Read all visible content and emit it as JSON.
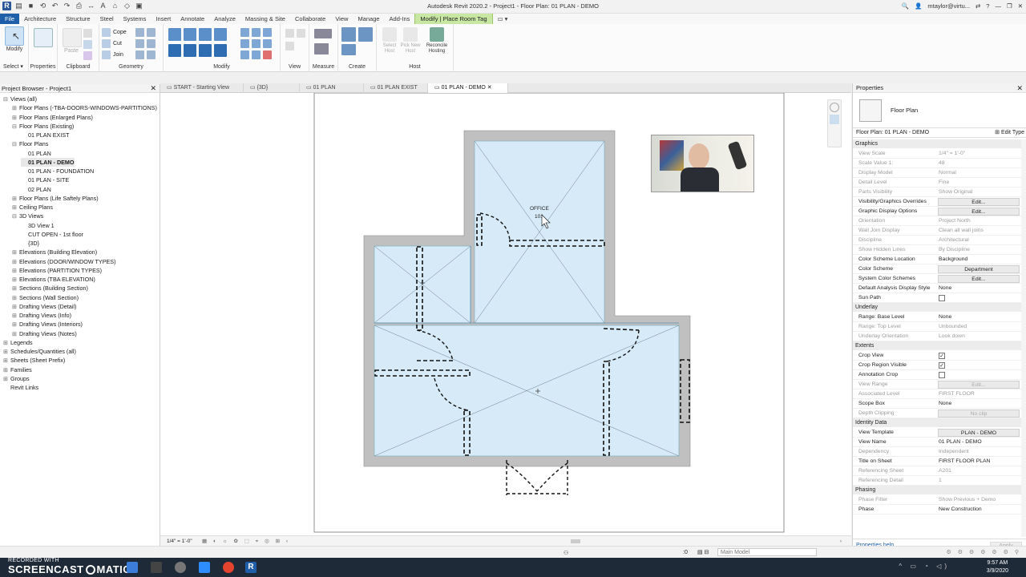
{
  "title": "Autodesk Revit 2020.2 - Project1 - Floor Plan: 01 PLAN - DEMO",
  "user": "mtaylor@virtu...",
  "ribbon_tabs": [
    "File",
    "Architecture",
    "Structure",
    "Steel",
    "Systems",
    "Insert",
    "Annotate",
    "Analyze",
    "Massing & Site",
    "Collaborate",
    "View",
    "Manage",
    "Add-Ins",
    "Modify | Place Room Tag"
  ],
  "ribbon": {
    "modify": "Modify",
    "select": "Select",
    "properties": "Properties",
    "clipboard": "Clipboard",
    "paste": "Paste",
    "cope": "Cope",
    "cut": "Cut",
    "join": "Join",
    "geometry": "Geometry",
    "modify_panel": "Modify",
    "view": "View",
    "measure": "Measure",
    "create": "Create",
    "host": "Host",
    "select_host": "Select Host",
    "pick_new_host": "Pick New Host",
    "reconcile_hosting": "Reconcile Hosting"
  },
  "project_browser": {
    "title": "Project Browser - Project1",
    "items": [
      {
        "label": "Views (all)",
        "exp": "⊟",
        "indent": 0
      },
      {
        "label": "Floor Plans (-TBA-DOORS-WINDOWS-PARTITIONS)",
        "exp": "⊞",
        "indent": 1
      },
      {
        "label": "Floor Plans (Enlarged Plans)",
        "exp": "⊞",
        "indent": 1
      },
      {
        "label": "Floor Plans (Existing)",
        "exp": "⊟",
        "indent": 1
      },
      {
        "label": "01 PLAN EXIST",
        "exp": "",
        "indent": 2
      },
      {
        "label": "Floor Plans",
        "exp": "⊟",
        "indent": 1
      },
      {
        "label": "01 PLAN",
        "exp": "",
        "indent": 2
      },
      {
        "label": "01 PLAN - DEMO",
        "exp": "",
        "indent": 2,
        "bold": true
      },
      {
        "label": "01 PLAN - FOUNDATION",
        "exp": "",
        "indent": 2
      },
      {
        "label": "01 PLAN - SITE",
        "exp": "",
        "indent": 2
      },
      {
        "label": "02 PLAN",
        "exp": "",
        "indent": 2
      },
      {
        "label": "Floor Plans (Life Saftely Plans)",
        "exp": "⊞",
        "indent": 1
      },
      {
        "label": "Ceiling Plans",
        "exp": "⊞",
        "indent": 1
      },
      {
        "label": "3D Views",
        "exp": "⊟",
        "indent": 1
      },
      {
        "label": "3D View 1",
        "exp": "",
        "indent": 2
      },
      {
        "label": "CUT OPEN - 1st floor",
        "exp": "",
        "indent": 2
      },
      {
        "label": "{3D}",
        "exp": "",
        "indent": 2
      },
      {
        "label": "Elevations (Building Elevation)",
        "exp": "⊞",
        "indent": 1
      },
      {
        "label": "Elevations (DOOR/WINDOW TYPES)",
        "exp": "⊞",
        "indent": 1
      },
      {
        "label": "Elevations (PARTITION TYPES)",
        "exp": "⊞",
        "indent": 1
      },
      {
        "label": "Elevations (TBA ELEVATION)",
        "exp": "⊞",
        "indent": 1
      },
      {
        "label": "Sections (Building Section)",
        "exp": "⊞",
        "indent": 1
      },
      {
        "label": "Sections (Wall Section)",
        "exp": "⊞",
        "indent": 1
      },
      {
        "label": "Drafting Views (Detail)",
        "exp": "⊞",
        "indent": 1
      },
      {
        "label": "Drafting Views (Info)",
        "exp": "⊞",
        "indent": 1
      },
      {
        "label": "Drafting Views (Interiors)",
        "exp": "⊞",
        "indent": 1
      },
      {
        "label": "Drafting Views (Notes)",
        "exp": "⊞",
        "indent": 1
      },
      {
        "label": "Legends",
        "exp": "⊞",
        "indent": 0
      },
      {
        "label": "Schedules/Quantities (all)",
        "exp": "⊞",
        "indent": 0
      },
      {
        "label": "Sheets (Sheet Prefix)",
        "exp": "⊞",
        "indent": 0
      },
      {
        "label": "Families",
        "exp": "⊞",
        "indent": 0
      },
      {
        "label": "Groups",
        "exp": "⊞",
        "indent": 0
      },
      {
        "label": "Revit Links",
        "exp": "",
        "indent": 0
      }
    ]
  },
  "view_tabs": [
    {
      "label": "START - Starting View",
      "active": false
    },
    {
      "label": "{3D}",
      "active": false
    },
    {
      "label": "01 PLAN",
      "active": false
    },
    {
      "label": "01 PLAN EXIST",
      "active": false
    },
    {
      "label": "01 PLAN - DEMO",
      "active": true
    }
  ],
  "plan": {
    "room_name": "OFFICE",
    "room_number": "101"
  },
  "properties": {
    "title": "Properties",
    "type_name": "Floor Plan",
    "instance": "Floor Plan: 01 PLAN - DEMO",
    "edit_type": "Edit Type",
    "rows": [
      {
        "section": "Graphics"
      },
      {
        "k": "View Scale",
        "v": "1/4\" = 1'-0\"",
        "dim": true
      },
      {
        "k": "Scale Value  1:",
        "v": "48",
        "dim": true
      },
      {
        "k": "Display Model",
        "v": "Normal",
        "dim": true
      },
      {
        "k": "Detail Level",
        "v": "Fine",
        "dim": true
      },
      {
        "k": "Parts Visibility",
        "v": "Show Original",
        "dim": true
      },
      {
        "k": "Visibility/Graphics Overrides",
        "btn": "Edit..."
      },
      {
        "k": "Graphic Display Options",
        "btn": "Edit..."
      },
      {
        "k": "Orientation",
        "v": "Project North",
        "dim": true
      },
      {
        "k": "Wall Join Display",
        "v": "Clean all wall joins",
        "dim": true
      },
      {
        "k": "Discipline",
        "v": "Architectural",
        "dim": true
      },
      {
        "k": "Show Hidden Lines",
        "v": "By Discipline",
        "dim": true
      },
      {
        "k": "Color Scheme Location",
        "v": "Background"
      },
      {
        "k": "Color Scheme",
        "btn": "Department"
      },
      {
        "k": "System Color Schemes",
        "btn": "Edit..."
      },
      {
        "k": "Default Analysis Display Style",
        "v": "None"
      },
      {
        "k": "Sun Path",
        "check": false
      },
      {
        "section": "Underlay"
      },
      {
        "k": "Range: Base Level",
        "v": "None"
      },
      {
        "k": "Range: Top Level",
        "v": "Unbounded",
        "dim": true
      },
      {
        "k": "Underlay Orientation",
        "v": "Look down",
        "dim": true
      },
      {
        "section": "Extents"
      },
      {
        "k": "Crop View",
        "check": true
      },
      {
        "k": "Crop Region Visible",
        "check": true
      },
      {
        "k": "Annotation Crop",
        "check": false
      },
      {
        "k": "View Range",
        "btn": "Edit...",
        "dim": true
      },
      {
        "k": "Associated Level",
        "v": "FIRST FLOOR",
        "dim": true
      },
      {
        "k": "Scope Box",
        "v": "None"
      },
      {
        "k": "Depth Clipping",
        "btn": "No clip",
        "dim": true
      },
      {
        "section": "Identity Data"
      },
      {
        "k": "View Template",
        "btn": "PLAN - DEMO"
      },
      {
        "k": "View Name",
        "v": "01 PLAN - DEMO"
      },
      {
        "k": "Dependency",
        "v": "Independent",
        "dim": true
      },
      {
        "k": "Title on Sheet",
        "v": "FIRST FLOOR PLAN"
      },
      {
        "k": "Referencing Sheet",
        "v": "A201",
        "dim": true
      },
      {
        "k": "Referencing Detail",
        "v": "1",
        "dim": true
      },
      {
        "section": "Phasing"
      },
      {
        "k": "Phase Filter",
        "v": "Show Previous + Demo",
        "dim": true
      },
      {
        "k": "Phase",
        "v": "New Construction"
      }
    ],
    "help": "Properties help",
    "apply": "Apply"
  },
  "view_bar": {
    "scale": "1/4\" = 1'-0\""
  },
  "status": {
    "model": "Main Model",
    "zero": ":0"
  },
  "taskbar": {
    "rec": "RECORDED WITH",
    "brand": "SCREENCAST",
    "brand2": "MATIC",
    "time": "9:57 AM",
    "date": "3/9/2020"
  },
  "colors": {
    "file_tab": "#1f5ea8",
    "context_tab": "#c7e7a3",
    "room_fill": "#d6eaf8",
    "wall": "#c0c0c0"
  }
}
